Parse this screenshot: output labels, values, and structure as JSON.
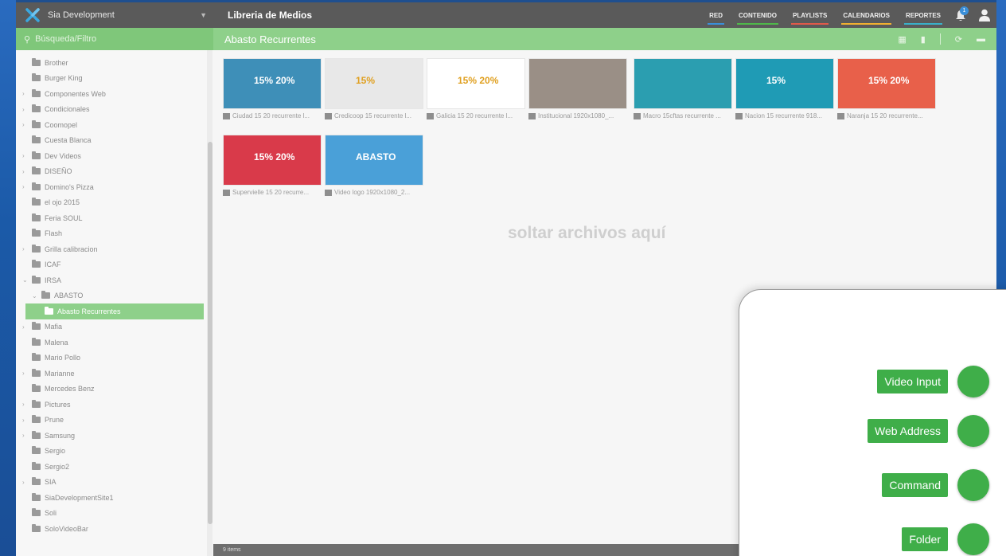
{
  "topbar": {
    "app_name": "Sia Development",
    "section_title": "Libreria de Medios",
    "nav": [
      {
        "label": "RED",
        "color": "#3a8fd9"
      },
      {
        "label": "CONTENIDO",
        "color": "#4fb84a"
      },
      {
        "label": "PLAYLISTS",
        "color": "#e05a4a"
      },
      {
        "label": "CALENDARIOS",
        "color": "#f0b030"
      },
      {
        "label": "REPORTES",
        "color": "#3ab0c8"
      }
    ],
    "notification_count": "1"
  },
  "search": {
    "placeholder": "Búsqueda/Filtro"
  },
  "folder": {
    "title": "Abasto Recurrentes"
  },
  "tree": [
    {
      "label": "Brother",
      "caret": ""
    },
    {
      "label": "Burger King",
      "caret": ""
    },
    {
      "label": "Componentes Web",
      "caret": ">"
    },
    {
      "label": "Condicionales",
      "caret": ">"
    },
    {
      "label": "Coomopel",
      "caret": ">"
    },
    {
      "label": "Cuesta Blanca",
      "caret": ""
    },
    {
      "label": "Dev Videos",
      "caret": ">"
    },
    {
      "label": "DISEÑO",
      "caret": ">"
    },
    {
      "label": "Domino's Pizza",
      "caret": ">"
    },
    {
      "label": "el ojo 2015",
      "caret": ""
    },
    {
      "label": "Feria SOUL",
      "caret": ""
    },
    {
      "label": "Flash",
      "caret": ""
    },
    {
      "label": "Grilla calibracion",
      "caret": ">"
    },
    {
      "label": "ICAF",
      "caret": ""
    },
    {
      "label": "IRSA",
      "caret": "v"
    },
    {
      "label": "ABASTO",
      "caret": "v",
      "indent": 1
    },
    {
      "label": "Abasto Recurrentes",
      "caret": "",
      "selected": true
    },
    {
      "label": "Mafia",
      "caret": ">"
    },
    {
      "label": "Malena",
      "caret": ""
    },
    {
      "label": "Mario Pollo",
      "caret": ""
    },
    {
      "label": "Marianne",
      "caret": ">"
    },
    {
      "label": "Mercedes Benz",
      "caret": ""
    },
    {
      "label": "Pictures",
      "caret": ">"
    },
    {
      "label": "Prune",
      "caret": ">"
    },
    {
      "label": "Samsung",
      "caret": ">"
    },
    {
      "label": "Sergio",
      "caret": ""
    },
    {
      "label": "Sergio2",
      "caret": ""
    },
    {
      "label": "SIA",
      "caret": ">"
    },
    {
      "label": "SiaDevelopmentSite1",
      "caret": ""
    },
    {
      "label": "Soli",
      "caret": ""
    },
    {
      "label": "SoloVideoBar",
      "caret": ""
    }
  ],
  "media": {
    "items": [
      {
        "caption": "Ciudad 15 20 recurrente l...",
        "bg": "#3e8fb8",
        "promo": "15% 20%"
      },
      {
        "caption": "Credicoop 15 recurrente l...",
        "bg": "#e8e8e8",
        "promo": "15%"
      },
      {
        "caption": "Galicia 15 20 recurrente l...",
        "bg": "#ffffff",
        "promo": "15% 20%"
      },
      {
        "caption": "Institucional 1920x1080_...",
        "bg": "#9a8f86",
        "promo": ""
      },
      {
        "caption": "Macro 15cftas recurrente ...",
        "bg": "#2b9eb0",
        "promo": ""
      },
      {
        "caption": "Nacion 15 recurrente 918...",
        "bg": "#1f9bb5",
        "promo": "15%"
      },
      {
        "caption": "Naranja 15 20 recurrente...",
        "bg": "#e8604a",
        "promo": "15% 20%"
      },
      {
        "caption": "Supervielle 15 20 recurre...",
        "bg": "#d93a4a",
        "promo": "15% 20%"
      },
      {
        "caption": "Video logo 1920x1080_2...",
        "bg": "#4aa0d8",
        "promo": "ABASTO"
      }
    ],
    "drop_text": "soltar archivos aquí",
    "status": "9 items"
  },
  "fab_menu": [
    {
      "label": "Video Input"
    },
    {
      "label": "Web Address"
    },
    {
      "label": "Command"
    },
    {
      "label": "Folder"
    }
  ]
}
